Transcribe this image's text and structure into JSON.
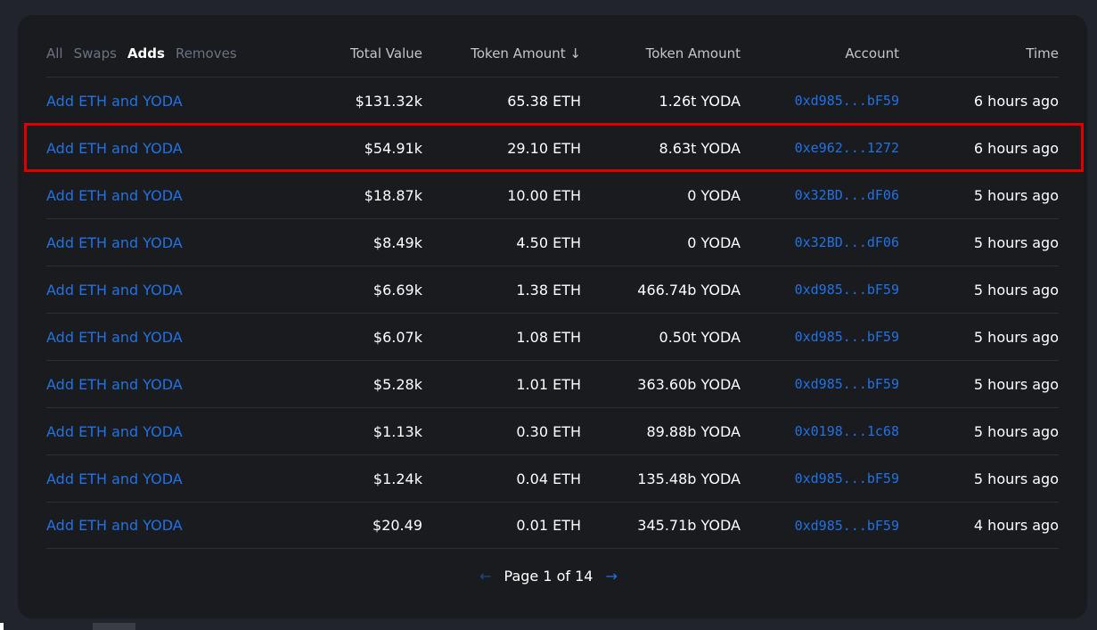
{
  "filters": {
    "all": "All",
    "swaps": "Swaps",
    "adds": "Adds",
    "removes": "Removes",
    "active": "Adds"
  },
  "columns": {
    "total_value": "Total Value",
    "token_amount_sorted": "Token Amount ↓",
    "token_amount": "Token Amount",
    "account": "Account",
    "time": "Time"
  },
  "rows": [
    {
      "type": "Add ETH and YODA",
      "total": "$131.32k",
      "eth": "65.38 ETH",
      "yoda": "1.26t YODA",
      "account": "0xd985...bF59",
      "time": "6 hours ago"
    },
    {
      "type": "Add ETH and YODA",
      "total": "$54.91k",
      "eth": "29.10 ETH",
      "yoda": "8.63t YODA",
      "account": "0xe962...1272",
      "time": "6 hours ago"
    },
    {
      "type": "Add ETH and YODA",
      "total": "$18.87k",
      "eth": "10.00 ETH",
      "yoda": "0 YODA",
      "account": "0x32BD...dF06",
      "time": "5 hours ago"
    },
    {
      "type": "Add ETH and YODA",
      "total": "$8.49k",
      "eth": "4.50 ETH",
      "yoda": "0 YODA",
      "account": "0x32BD...dF06",
      "time": "5 hours ago"
    },
    {
      "type": "Add ETH and YODA",
      "total": "$6.69k",
      "eth": "1.38 ETH",
      "yoda": "466.74b YODA",
      "account": "0xd985...bF59",
      "time": "5 hours ago"
    },
    {
      "type": "Add ETH and YODA",
      "total": "$6.07k",
      "eth": "1.08 ETH",
      "yoda": "0.50t YODA",
      "account": "0xd985...bF59",
      "time": "5 hours ago"
    },
    {
      "type": "Add ETH and YODA",
      "total": "$5.28k",
      "eth": "1.01 ETH",
      "yoda": "363.60b YODA",
      "account": "0xd985...bF59",
      "time": "5 hours ago"
    },
    {
      "type": "Add ETH and YODA",
      "total": "$1.13k",
      "eth": "0.30 ETH",
      "yoda": "89.88b YODA",
      "account": "0x0198...1c68",
      "time": "5 hours ago"
    },
    {
      "type": "Add ETH and YODA",
      "total": "$1.24k",
      "eth": "0.04 ETH",
      "yoda": "135.48b YODA",
      "account": "0xd985...bF59",
      "time": "5 hours ago"
    },
    {
      "type": "Add ETH and YODA",
      "total": "$20.49",
      "eth": "0.01 ETH",
      "yoda": "345.71b YODA",
      "account": "0xd985...bF59",
      "time": "4 hours ago"
    }
  ],
  "pagination": {
    "text": "Page 1 of 14",
    "prev_icon": "arrow-left-icon",
    "next_icon": "arrow-right-icon"
  },
  "highlight_row_index": 1,
  "colors": {
    "background": "#21242b",
    "panel": "#191b1f",
    "link": "#2172e5",
    "highlight": "#e00000"
  }
}
